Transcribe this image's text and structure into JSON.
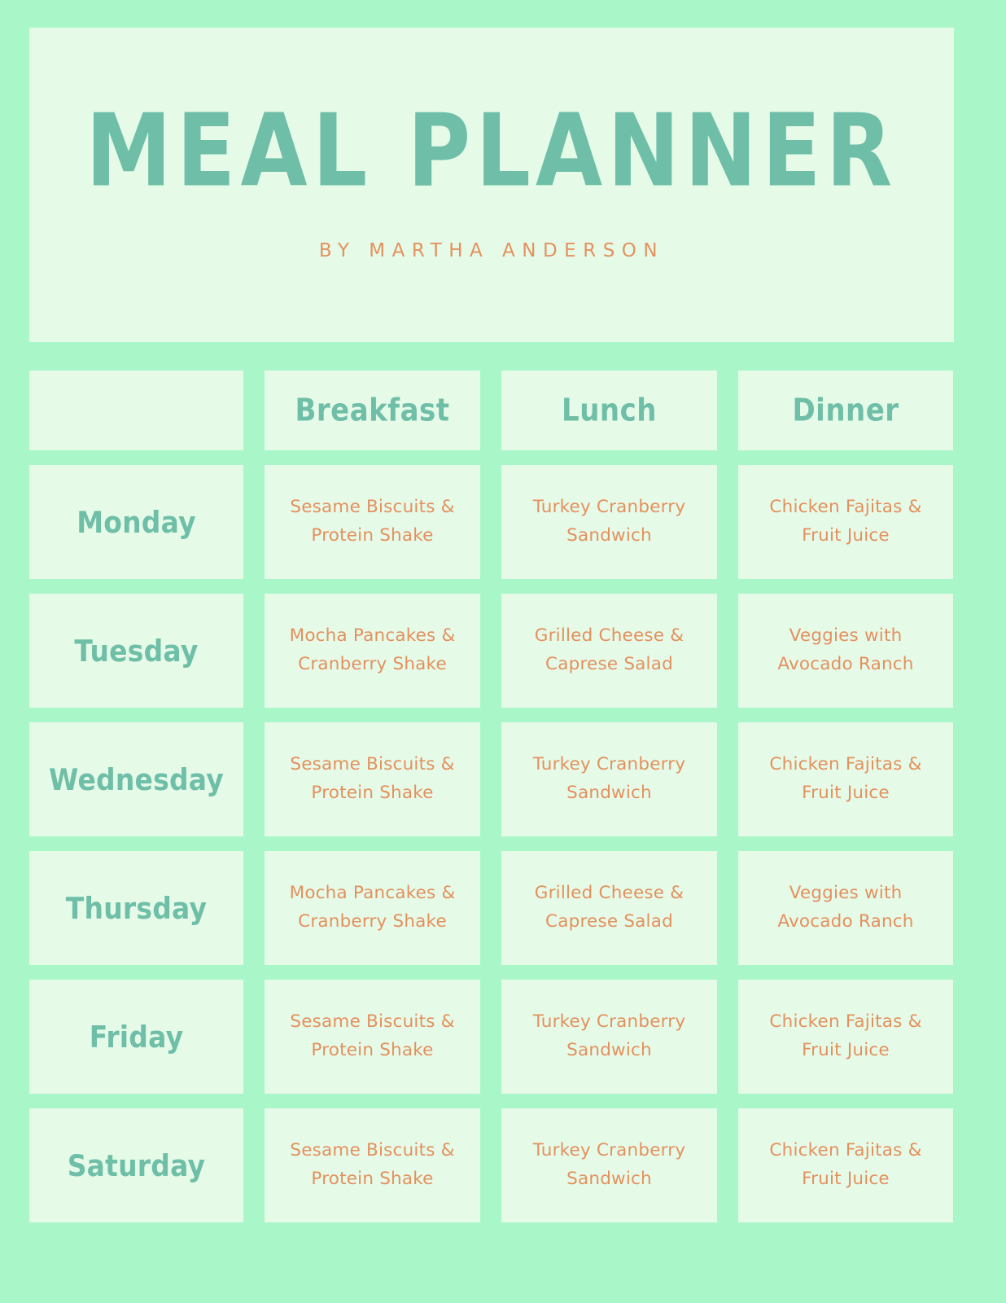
{
  "theme": {
    "background": "#a9f7c9",
    "card": "#e6fae8",
    "heading_color": "#6fbfa8",
    "accent_color": "#e3915e"
  },
  "header": {
    "title": "MEAL PLANNER",
    "subtitle": "BY MARTHA ANDERSON"
  },
  "table": {
    "columns": [
      "",
      "Breakfast",
      "Lunch",
      "Dinner"
    ],
    "rows": [
      {
        "day": "Monday",
        "breakfast": "Sesame Biscuits & Protein Shake",
        "lunch": "Turkey Cranberry Sandwich",
        "dinner": "Chicken Fajitas & Fruit Juice"
      },
      {
        "day": "Tuesday",
        "breakfast": "Mocha Pancakes & Cranberry Shake",
        "lunch": "Grilled Cheese & Caprese Salad",
        "dinner": "Veggies with Avocado Ranch"
      },
      {
        "day": "Wednesday",
        "breakfast": "Sesame Biscuits & Protein Shake",
        "lunch": "Turkey Cranberry Sandwich",
        "dinner": "Chicken Fajitas & Fruit Juice"
      },
      {
        "day": "Thursday",
        "breakfast": "Mocha Pancakes & Cranberry Shake",
        "lunch": "Grilled Cheese & Caprese Salad",
        "dinner": "Veggies with Avocado Ranch"
      },
      {
        "day": "Friday",
        "breakfast": "Sesame Biscuits & Protein Shake",
        "lunch": "Turkey Cranberry Sandwich",
        "dinner": "Chicken Fajitas & Fruit Juice"
      },
      {
        "day": "Saturday",
        "breakfast": "Sesame Biscuits & Protein Shake",
        "lunch": "Turkey Cranberry Sandwich",
        "dinner": "Chicken Fajitas & Fruit Juice"
      }
    ]
  }
}
